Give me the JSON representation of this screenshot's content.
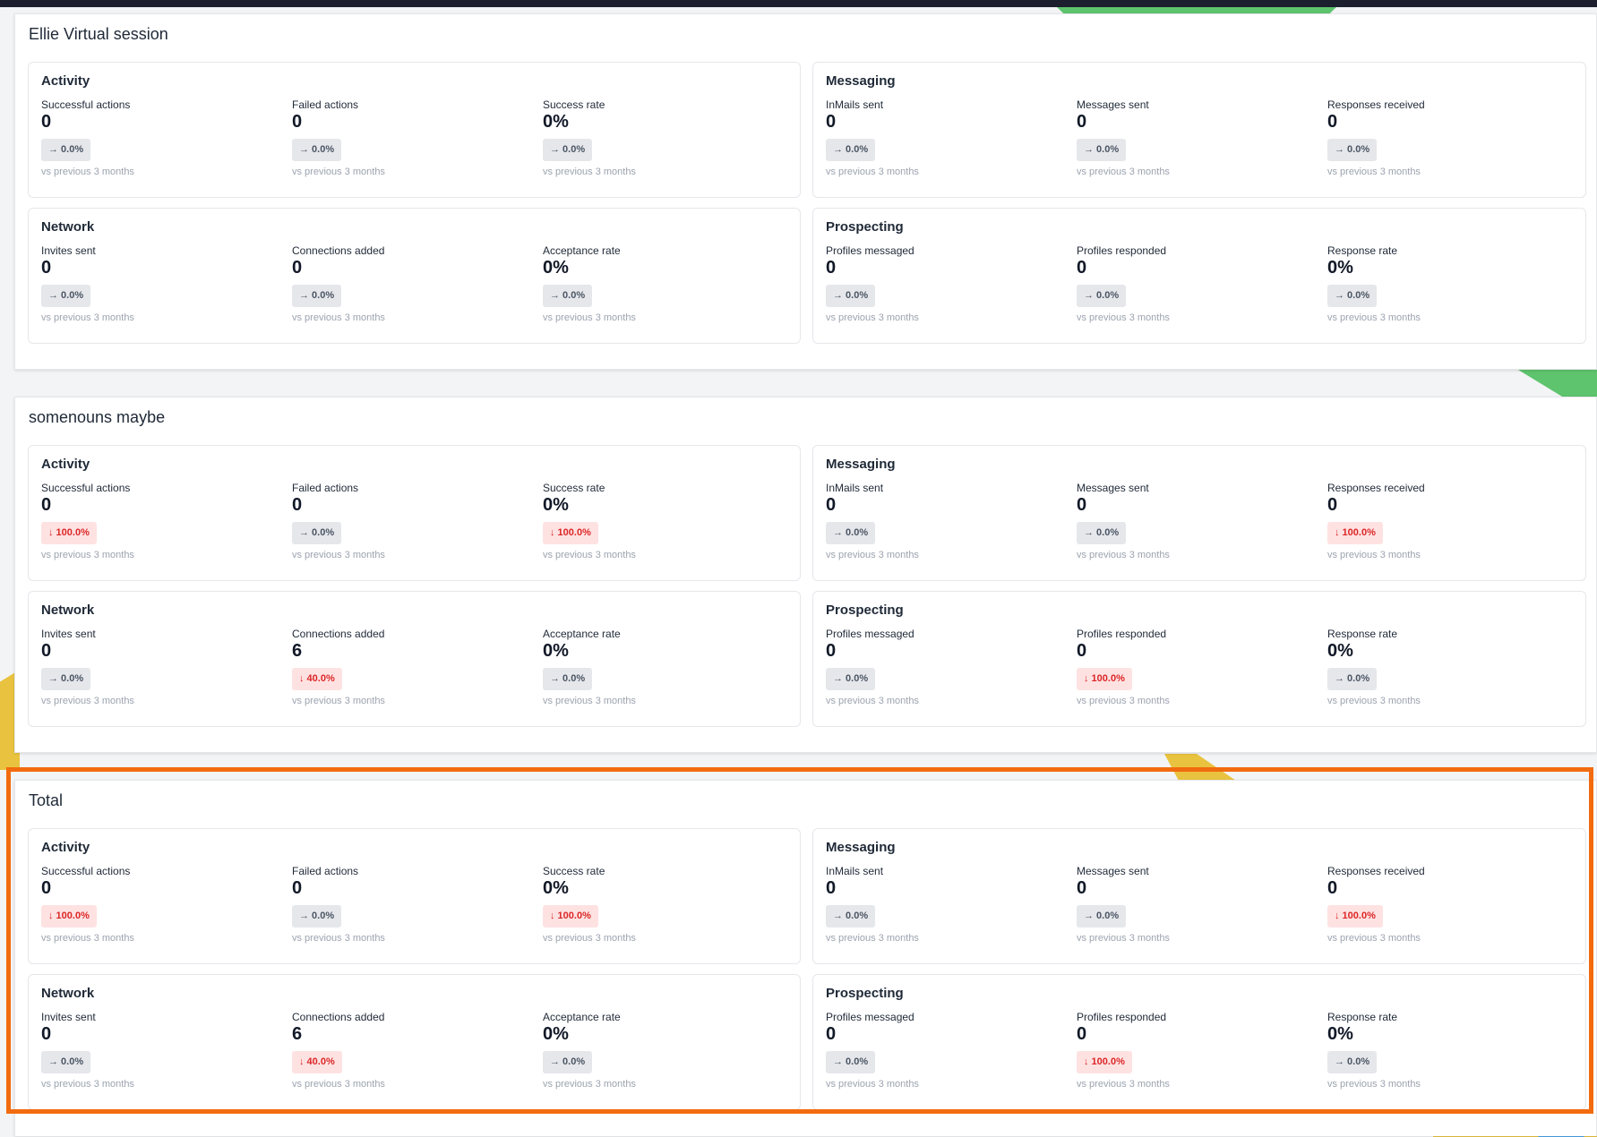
{
  "colors": {
    "highlight": "#f26b0f",
    "down_badge_bg": "#fee2e2",
    "down_badge_text": "#dc2626",
    "neutral_badge_bg": "#e5e7eb"
  },
  "sessions": [
    {
      "title": "Ellie Virtual session",
      "activity": {
        "title": "Activity",
        "metrics": [
          {
            "label": "Successful actions",
            "value": "0",
            "change": "→ 0.0%",
            "note": "vs previous 3 months"
          },
          {
            "label": "Failed actions",
            "value": "0",
            "change": "→ 0.0%",
            "note": "vs previous 3 months"
          },
          {
            "label": "Success rate",
            "value": "0%",
            "change": "→ 0.0%",
            "note": "vs previous 3 months"
          }
        ]
      },
      "messaging": {
        "title": "Messaging",
        "metrics": [
          {
            "label": "InMails sent",
            "value": "0",
            "change": "→ 0.0%",
            "note": "vs previous 3 months"
          },
          {
            "label": "Messages sent",
            "value": "0",
            "change": "→ 0.0%",
            "note": "vs previous 3 months"
          },
          {
            "label": "Responses received",
            "value": "0",
            "change": "→ 0.0%",
            "note": "vs previous 3 months"
          }
        ]
      },
      "network": {
        "title": "Network",
        "metrics": [
          {
            "label": "Invites sent",
            "value": "0",
            "change": "→ 0.0%",
            "note": "vs previous 3 months"
          },
          {
            "label": "Connections added",
            "value": "0",
            "change": "→ 0.0%",
            "note": "vs previous 3 months"
          },
          {
            "label": "Acceptance rate",
            "value": "0%",
            "change": "→ 0.0%",
            "note": "vs previous 3 months"
          }
        ]
      },
      "prospecting": {
        "title": "Prospecting",
        "metrics": [
          {
            "label": "Profiles messaged",
            "value": "0",
            "change": "→ 0.0%",
            "note": "vs previous 3 months"
          },
          {
            "label": "Profiles responded",
            "value": "0",
            "change": "→ 0.0%",
            "note": "vs previous 3 months"
          },
          {
            "label": "Response rate",
            "value": "0%",
            "change": "→ 0.0%",
            "note": "vs previous 3 months"
          }
        ]
      }
    },
    {
      "title": "somenouns maybe",
      "activity": {
        "title": "Activity",
        "metrics": [
          {
            "label": "Successful actions",
            "value": "0",
            "change": "↓ 100.0%",
            "note": "vs previous 3 months"
          },
          {
            "label": "Failed actions",
            "value": "0",
            "change": "→ 0.0%",
            "note": "vs previous 3 months"
          },
          {
            "label": "Success rate",
            "value": "0%",
            "change": "↓ 100.0%",
            "note": "vs previous 3 months"
          }
        ]
      },
      "messaging": {
        "title": "Messaging",
        "metrics": [
          {
            "label": "InMails sent",
            "value": "0",
            "change": "→ 0.0%",
            "note": "vs previous 3 months"
          },
          {
            "label": "Messages sent",
            "value": "0",
            "change": "→ 0.0%",
            "note": "vs previous 3 months"
          },
          {
            "label": "Responses received",
            "value": "0",
            "change": "↓ 100.0%",
            "note": "vs previous 3 months"
          }
        ]
      },
      "network": {
        "title": "Network",
        "metrics": [
          {
            "label": "Invites sent",
            "value": "0",
            "change": "→ 0.0%",
            "note": "vs previous 3 months"
          },
          {
            "label": "Connections added",
            "value": "6",
            "change": "↓ 40.0%",
            "note": "vs previous 3 months"
          },
          {
            "label": "Acceptance rate",
            "value": "0%",
            "change": "→ 0.0%",
            "note": "vs previous 3 months"
          }
        ]
      },
      "prospecting": {
        "title": "Prospecting",
        "metrics": [
          {
            "label": "Profiles messaged",
            "value": "0",
            "change": "→ 0.0%",
            "note": "vs previous 3 months"
          },
          {
            "label": "Profiles responded",
            "value": "0",
            "change": "↓ 100.0%",
            "note": "vs previous 3 months"
          },
          {
            "label": "Response rate",
            "value": "0%",
            "change": "→ 0.0%",
            "note": "vs previous 3 months"
          }
        ]
      }
    },
    {
      "title": "Total",
      "activity": {
        "title": "Activity",
        "metrics": [
          {
            "label": "Successful actions",
            "value": "0",
            "change": "↓ 100.0%",
            "note": "vs previous 3 months"
          },
          {
            "label": "Failed actions",
            "value": "0",
            "change": "→ 0.0%",
            "note": "vs previous 3 months"
          },
          {
            "label": "Success rate",
            "value": "0%",
            "change": "↓ 100.0%",
            "note": "vs previous 3 months"
          }
        ]
      },
      "messaging": {
        "title": "Messaging",
        "metrics": [
          {
            "label": "InMails sent",
            "value": "0",
            "change": "→ 0.0%",
            "note": "vs previous 3 months"
          },
          {
            "label": "Messages sent",
            "value": "0",
            "change": "→ 0.0%",
            "note": "vs previous 3 months"
          },
          {
            "label": "Responses received",
            "value": "0",
            "change": "↓ 100.0%",
            "note": "vs previous 3 months"
          }
        ]
      },
      "network": {
        "title": "Network",
        "metrics": [
          {
            "label": "Invites sent",
            "value": "0",
            "change": "→ 0.0%",
            "note": "vs previous 3 months"
          },
          {
            "label": "Connections added",
            "value": "6",
            "change": "↓ 40.0%",
            "note": "vs previous 3 months"
          },
          {
            "label": "Acceptance rate",
            "value": "0%",
            "change": "→ 0.0%",
            "note": "vs previous 3 months"
          }
        ]
      },
      "prospecting": {
        "title": "Prospecting",
        "metrics": [
          {
            "label": "Profiles messaged",
            "value": "0",
            "change": "→ 0.0%",
            "note": "vs previous 3 months"
          },
          {
            "label": "Profiles responded",
            "value": "0",
            "change": "↓ 100.0%",
            "note": "vs previous 3 months"
          },
          {
            "label": "Response rate",
            "value": "0%",
            "change": "→ 0.0%",
            "note": "vs previous 3 months"
          }
        ]
      }
    }
  ]
}
